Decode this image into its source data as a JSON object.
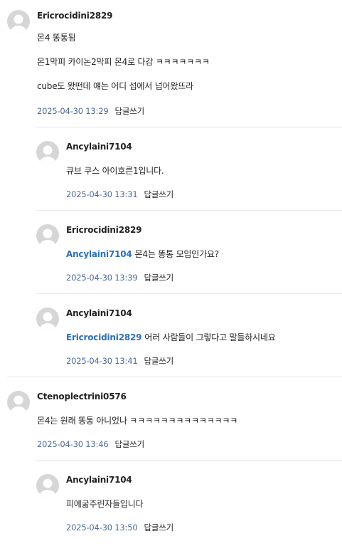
{
  "colors": {
    "mention": "#2e6fb5",
    "date": "#4e6a9a",
    "avatar_bg": "#d6d6d6",
    "divider": "#e8e8e8"
  },
  "comments": [
    {
      "author": "Ericrocidini2829",
      "lines": [
        {
          "mention": "",
          "text": "몬4 똥통됨"
        },
        {
          "mention": "",
          "text": "몬1막피 카이논2막피 몬4로 다감 ㅋㅋㅋㅋㅋㅋㅋ"
        },
        {
          "mention": "",
          "text": "cube도 왔떤데 얘는 어디 섭에서 넘어왔뜨라"
        }
      ],
      "date": "2025-04-30 13:29",
      "reply_label": "답글쓰기",
      "is_reply": false
    },
    {
      "author": "Ancylaini7104",
      "lines": [
        {
          "mention": "",
          "text": "큐브 쿠스 아이호른1입니다."
        }
      ],
      "date": "2025-04-30 13:31",
      "reply_label": "답글쓰기",
      "is_reply": true
    },
    {
      "author": "Ericrocidini2829",
      "lines": [
        {
          "mention": "Ancylaini7104",
          "text": "몬4는 똥통 모임인가요?"
        }
      ],
      "date": "2025-04-30 13:39",
      "reply_label": "답글쓰기",
      "is_reply": true
    },
    {
      "author": "Ancylaini7104",
      "lines": [
        {
          "mention": "Ericrocidini2829",
          "text": "어러 사람들이 그렇다고 말들하시네요"
        }
      ],
      "date": "2025-04-30 13:41",
      "reply_label": "답글쓰기",
      "is_reply": true
    },
    {
      "author": "Ctenoplectrini0576",
      "lines": [
        {
          "mention": "",
          "text": "몬4는 원래 똥통 아니었나 ㅋㅋㅋㅋㅋㅋㅋㅋㅋㅋㅋㅋㅋㅋ"
        }
      ],
      "date": "2025-04-30 13:46",
      "reply_label": "답글쓰기",
      "is_reply": false
    },
    {
      "author": "Ancylaini7104",
      "lines": [
        {
          "mention": "",
          "text": "피에굶주린자들입니다"
        }
      ],
      "date": "2025-04-30 13:50",
      "reply_label": "답글쓰기",
      "is_reply": true
    }
  ]
}
